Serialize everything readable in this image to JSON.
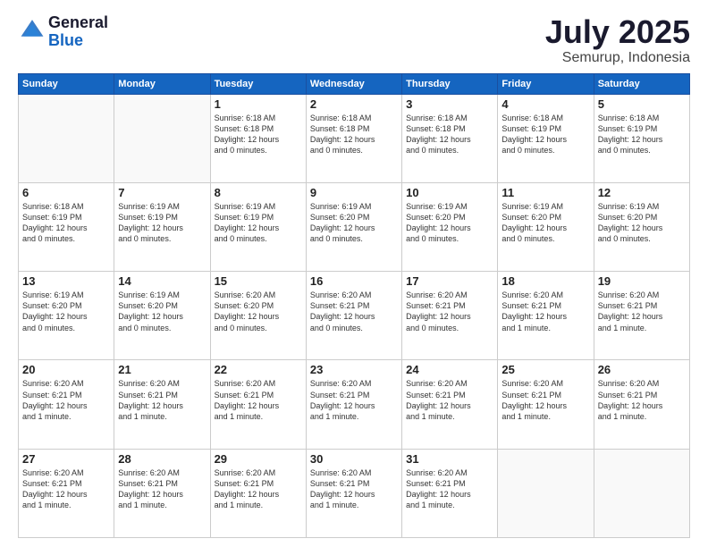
{
  "header": {
    "logo_line1": "General",
    "logo_line2": "Blue",
    "month": "July 2025",
    "location": "Semurup, Indonesia"
  },
  "days_of_week": [
    "Sunday",
    "Monday",
    "Tuesday",
    "Wednesday",
    "Thursday",
    "Friday",
    "Saturday"
  ],
  "weeks": [
    [
      {
        "num": "",
        "info": ""
      },
      {
        "num": "",
        "info": ""
      },
      {
        "num": "1",
        "info": "Sunrise: 6:18 AM\nSunset: 6:18 PM\nDaylight: 12 hours\nand 0 minutes."
      },
      {
        "num": "2",
        "info": "Sunrise: 6:18 AM\nSunset: 6:18 PM\nDaylight: 12 hours\nand 0 minutes."
      },
      {
        "num": "3",
        "info": "Sunrise: 6:18 AM\nSunset: 6:18 PM\nDaylight: 12 hours\nand 0 minutes."
      },
      {
        "num": "4",
        "info": "Sunrise: 6:18 AM\nSunset: 6:19 PM\nDaylight: 12 hours\nand 0 minutes."
      },
      {
        "num": "5",
        "info": "Sunrise: 6:18 AM\nSunset: 6:19 PM\nDaylight: 12 hours\nand 0 minutes."
      }
    ],
    [
      {
        "num": "6",
        "info": "Sunrise: 6:18 AM\nSunset: 6:19 PM\nDaylight: 12 hours\nand 0 minutes."
      },
      {
        "num": "7",
        "info": "Sunrise: 6:19 AM\nSunset: 6:19 PM\nDaylight: 12 hours\nand 0 minutes."
      },
      {
        "num": "8",
        "info": "Sunrise: 6:19 AM\nSunset: 6:19 PM\nDaylight: 12 hours\nand 0 minutes."
      },
      {
        "num": "9",
        "info": "Sunrise: 6:19 AM\nSunset: 6:20 PM\nDaylight: 12 hours\nand 0 minutes."
      },
      {
        "num": "10",
        "info": "Sunrise: 6:19 AM\nSunset: 6:20 PM\nDaylight: 12 hours\nand 0 minutes."
      },
      {
        "num": "11",
        "info": "Sunrise: 6:19 AM\nSunset: 6:20 PM\nDaylight: 12 hours\nand 0 minutes."
      },
      {
        "num": "12",
        "info": "Sunrise: 6:19 AM\nSunset: 6:20 PM\nDaylight: 12 hours\nand 0 minutes."
      }
    ],
    [
      {
        "num": "13",
        "info": "Sunrise: 6:19 AM\nSunset: 6:20 PM\nDaylight: 12 hours\nand 0 minutes."
      },
      {
        "num": "14",
        "info": "Sunrise: 6:19 AM\nSunset: 6:20 PM\nDaylight: 12 hours\nand 0 minutes."
      },
      {
        "num": "15",
        "info": "Sunrise: 6:20 AM\nSunset: 6:20 PM\nDaylight: 12 hours\nand 0 minutes."
      },
      {
        "num": "16",
        "info": "Sunrise: 6:20 AM\nSunset: 6:21 PM\nDaylight: 12 hours\nand 0 minutes."
      },
      {
        "num": "17",
        "info": "Sunrise: 6:20 AM\nSunset: 6:21 PM\nDaylight: 12 hours\nand 0 minutes."
      },
      {
        "num": "18",
        "info": "Sunrise: 6:20 AM\nSunset: 6:21 PM\nDaylight: 12 hours\nand 1 minute."
      },
      {
        "num": "19",
        "info": "Sunrise: 6:20 AM\nSunset: 6:21 PM\nDaylight: 12 hours\nand 1 minute."
      }
    ],
    [
      {
        "num": "20",
        "info": "Sunrise: 6:20 AM\nSunset: 6:21 PM\nDaylight: 12 hours\nand 1 minute."
      },
      {
        "num": "21",
        "info": "Sunrise: 6:20 AM\nSunset: 6:21 PM\nDaylight: 12 hours\nand 1 minute."
      },
      {
        "num": "22",
        "info": "Sunrise: 6:20 AM\nSunset: 6:21 PM\nDaylight: 12 hours\nand 1 minute."
      },
      {
        "num": "23",
        "info": "Sunrise: 6:20 AM\nSunset: 6:21 PM\nDaylight: 12 hours\nand 1 minute."
      },
      {
        "num": "24",
        "info": "Sunrise: 6:20 AM\nSunset: 6:21 PM\nDaylight: 12 hours\nand 1 minute."
      },
      {
        "num": "25",
        "info": "Sunrise: 6:20 AM\nSunset: 6:21 PM\nDaylight: 12 hours\nand 1 minute."
      },
      {
        "num": "26",
        "info": "Sunrise: 6:20 AM\nSunset: 6:21 PM\nDaylight: 12 hours\nand 1 minute."
      }
    ],
    [
      {
        "num": "27",
        "info": "Sunrise: 6:20 AM\nSunset: 6:21 PM\nDaylight: 12 hours\nand 1 minute."
      },
      {
        "num": "28",
        "info": "Sunrise: 6:20 AM\nSunset: 6:21 PM\nDaylight: 12 hours\nand 1 minute."
      },
      {
        "num": "29",
        "info": "Sunrise: 6:20 AM\nSunset: 6:21 PM\nDaylight: 12 hours\nand 1 minute."
      },
      {
        "num": "30",
        "info": "Sunrise: 6:20 AM\nSunset: 6:21 PM\nDaylight: 12 hours\nand 1 minute."
      },
      {
        "num": "31",
        "info": "Sunrise: 6:20 AM\nSunset: 6:21 PM\nDaylight: 12 hours\nand 1 minute."
      },
      {
        "num": "",
        "info": ""
      },
      {
        "num": "",
        "info": ""
      }
    ]
  ]
}
